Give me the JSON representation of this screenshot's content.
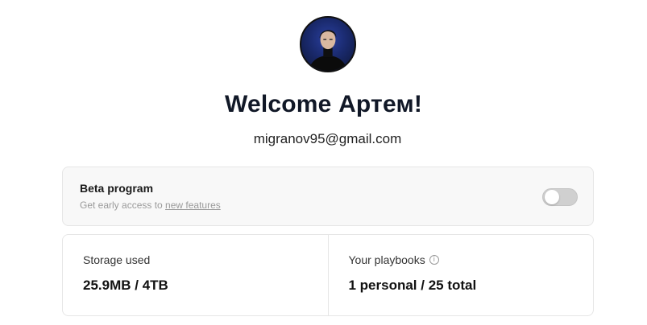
{
  "profile": {
    "avatar_icon": "user-photo",
    "welcome": "Welcome Артем!",
    "email": "migranov95@gmail.com"
  },
  "beta": {
    "title": "Beta program",
    "subtitle_prefix": "Get early access to ",
    "subtitle_link": "new features",
    "toggle_on": false
  },
  "stats": {
    "storage_label": "Storage used",
    "storage_value": "25.9MB / 4TB",
    "playbooks_label": "Your playbooks",
    "playbooks_info_icon": "info-icon",
    "playbooks_value": "1 personal / 25 total"
  }
}
